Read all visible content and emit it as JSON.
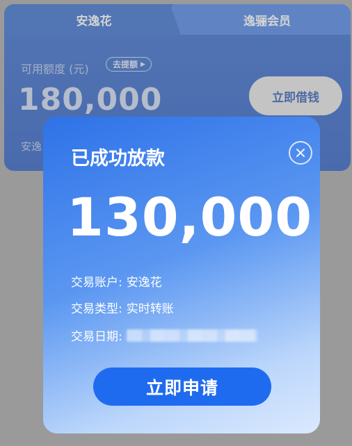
{
  "card": {
    "tabs": [
      "安逸花",
      "逸骊会员"
    ],
    "quota_label": "可用额度 (元)",
    "raise_badge": "去提额",
    "quota_amount": "180,000",
    "borrow_button": "立即借钱",
    "brand_text": "安逸"
  },
  "modal": {
    "title": "已成功放款",
    "amount": "130,000",
    "details": [
      {
        "label": "交易账户:",
        "value": "安逸花"
      },
      {
        "label": "交易类型:",
        "value": "实时转账"
      },
      {
        "label": "交易日期:",
        "value": ""
      }
    ],
    "apply_button": "立即申请"
  },
  "icons": {
    "close": "close-circle-icon",
    "raise_arrow": "triangle-right-icon"
  },
  "colors": {
    "accent": "#1f6bf0",
    "card_bg": "#3a6fd0",
    "borrow_text": "#2f5fb5"
  }
}
